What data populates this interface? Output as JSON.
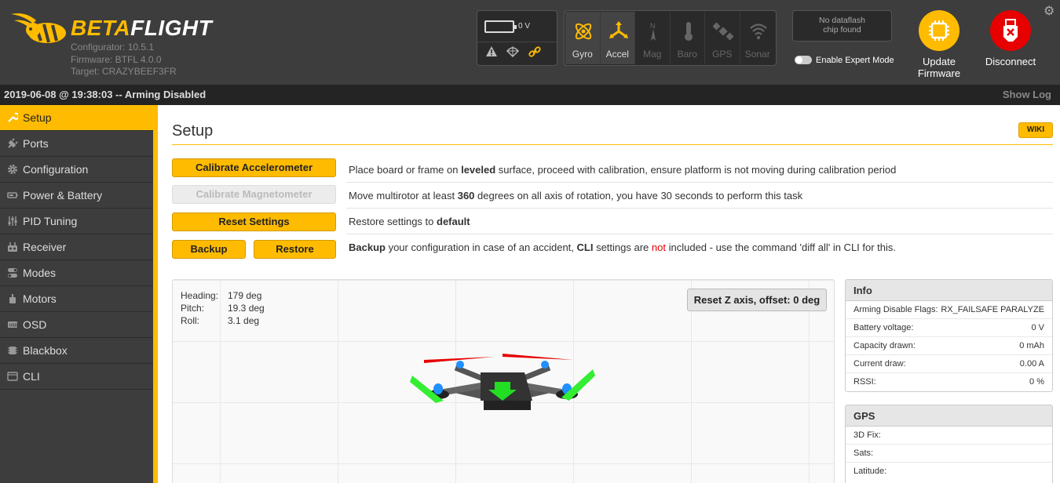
{
  "app": {
    "logo_bold": "BETA",
    "logo_light": "FLIGHT",
    "configurator": "Configurator: 10.5.1",
    "firmware": "Firmware: BTFL 4.0.0",
    "target": "Target: CRAZYBEEF3FR"
  },
  "battery": {
    "voltage": "0 V"
  },
  "sensors": [
    {
      "label": "Gyro",
      "active": true
    },
    {
      "label": "Accel",
      "active": true
    },
    {
      "label": "Mag",
      "active": false
    },
    {
      "label": "Baro",
      "active": false
    },
    {
      "label": "GPS",
      "active": false
    },
    {
      "label": "Sonar",
      "active": false
    }
  ],
  "dataflash": {
    "line1": "No dataflash",
    "line2": "chip found"
  },
  "expert_mode_label": "Enable Expert Mode",
  "header_buttons": {
    "update_line1": "Update",
    "update_line2": "Firmware",
    "disconnect": "Disconnect"
  },
  "logbar": {
    "status": "2019-06-08 @ 19:38:03 -- Arming Disabled",
    "show_log": "Show Log"
  },
  "sidebar": {
    "items": [
      {
        "label": "Setup",
        "icon": "wrench-icon"
      },
      {
        "label": "Ports",
        "icon": "plug-icon"
      },
      {
        "label": "Configuration",
        "icon": "gear-icon"
      },
      {
        "label": "Power & Battery",
        "icon": "battery-icon"
      },
      {
        "label": "PID Tuning",
        "icon": "sliders-icon"
      },
      {
        "label": "Receiver",
        "icon": "receiver-icon"
      },
      {
        "label": "Modes",
        "icon": "toggle-icon"
      },
      {
        "label": "Motors",
        "icon": "motor-icon"
      },
      {
        "label": "OSD",
        "icon": "osd-icon"
      },
      {
        "label": "Blackbox",
        "icon": "blackbox-icon"
      },
      {
        "label": "CLI",
        "icon": "terminal-icon"
      }
    ]
  },
  "setup": {
    "title": "Setup",
    "wiki": "WIKI",
    "calibrate_acc": "Calibrate Accelerometer",
    "calibrate_mag": "Calibrate Magnetometer",
    "reset_settings": "Reset Settings",
    "backup": "Backup",
    "restore": "Restore",
    "acc_text_1": "Place board or frame on ",
    "acc_text_bold": "leveled",
    "acc_text_2": " surface, proceed with calibration, ensure platform is not moving during calibration period",
    "mag_text_1": "Move multirotor at least ",
    "mag_text_bold": "360",
    "mag_text_2": " degrees on all axis of rotation, you have 30 seconds to perform this task",
    "reset_text_1": "Restore settings to ",
    "reset_text_bold": "default",
    "backup_text_bold1": "Backup",
    "backup_text_1": " your configuration in case of an accident, ",
    "backup_text_bold2": "CLI",
    "backup_text_2": " settings are ",
    "backup_text_red": "not",
    "backup_text_3": " included - use the command 'diff all' in CLI for this."
  },
  "attitude": {
    "heading_label": "Heading:",
    "heading": "179 deg",
    "pitch_label": "Pitch:",
    "pitch": "19.3 deg",
    "roll_label": "Roll:",
    "roll": "3.1 deg",
    "reset_z": "Reset Z axis, offset: 0 deg"
  },
  "info": {
    "title": "Info",
    "rows": [
      {
        "label": "Arming Disable Flags:",
        "value": "RX_FAILSAFE  PARALYZE"
      },
      {
        "label": "Battery voltage:",
        "value": "0 V"
      },
      {
        "label": "Capacity drawn:",
        "value": "0 mAh"
      },
      {
        "label": "Current draw:",
        "value": "0.00 A"
      },
      {
        "label": "RSSI:",
        "value": "0 %"
      }
    ]
  },
  "gps": {
    "title": "GPS",
    "rows": [
      {
        "label": "3D Fix:",
        "value": ""
      },
      {
        "label": "Sats:",
        "value": ""
      },
      {
        "label": "Latitude:",
        "value": ""
      }
    ]
  },
  "colors": {
    "accent": "#ffbb00",
    "header": "#3d3d3d",
    "update": "#ffbb00",
    "disconnect": "#e60000"
  }
}
